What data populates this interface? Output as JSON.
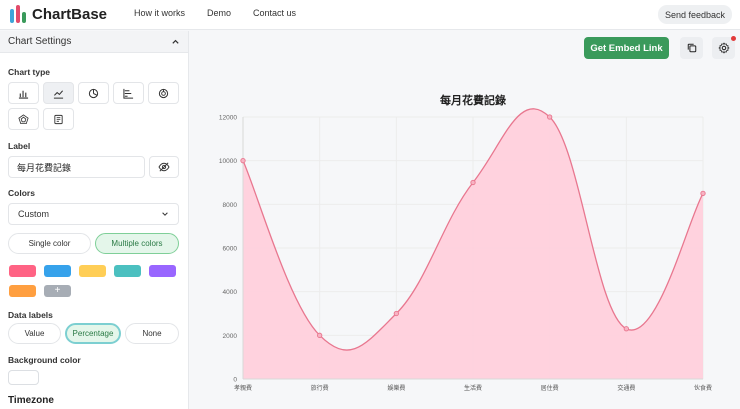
{
  "header": {
    "brand": "ChartBase",
    "nav": [
      "How it works",
      "Demo",
      "Contact us"
    ],
    "feedback_label": "Send feedback"
  },
  "sidebar": {
    "title": "Chart Settings",
    "chart_type_label": "Chart type",
    "label_label": "Label",
    "label_value": "每月花費記錄",
    "colors_label": "Colors",
    "colors_select": "Custom",
    "color_mode_options": [
      "Single color",
      "Multiple colors"
    ],
    "color_mode_selected": "Multiple colors",
    "swatches": [
      "#ff6384",
      "#36a2eb",
      "#ffce56",
      "#4bc0c0",
      "#9966ff",
      "#ff9f40"
    ],
    "add_swatch": "+",
    "data_labels_label": "Data labels",
    "data_label_options": [
      "Value",
      "Percentage",
      "None"
    ],
    "data_label_selected": "Percentage",
    "background_color_label": "Background color",
    "timezone_label": "Timezone"
  },
  "actions": {
    "embed_label": "Get Embed Link"
  },
  "colors": {
    "brand_green": "#3a9a5b",
    "line": "#e8778f",
    "fill": "#ffd0dc",
    "logo": [
      "#3da5d9",
      "#e24b6b",
      "#3a9a5b"
    ]
  },
  "chart_data": {
    "type": "area",
    "title": "每月花費記錄",
    "categories": [
      "孝親費",
      "旅行費",
      "娛樂費",
      "生活費",
      "居住費",
      "交通費",
      "伙食費"
    ],
    "series": [
      {
        "values": [
          10000,
          2000,
          3000,
          9000,
          12000,
          2300,
          8500
        ]
      }
    ],
    "ylim": [
      0,
      12000
    ],
    "yticks": [
      0,
      2000,
      4000,
      6000,
      8000,
      10000,
      12000
    ],
    "grid": true,
    "smooth": true
  }
}
